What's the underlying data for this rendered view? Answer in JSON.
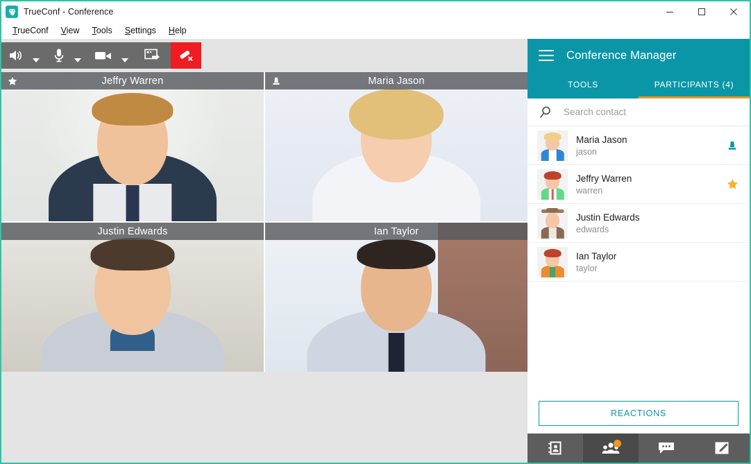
{
  "window": {
    "title": "TrueConf - Conference",
    "logo_icon": "trueconf-logo-icon",
    "controls": {
      "minimize": "minimize-icon",
      "maximize": "maximize-icon",
      "close": "close-icon"
    },
    "accent_border": "#2ec4a6"
  },
  "menubar": {
    "items": [
      {
        "label": "TrueConf",
        "mnemonic": "T",
        "rest": "rueConf"
      },
      {
        "label": "View",
        "mnemonic": "V",
        "rest": "iew"
      },
      {
        "label": "Tools",
        "mnemonic": "T",
        "rest": "ools"
      },
      {
        "label": "Settings",
        "mnemonic": "S",
        "rest": "ettings"
      },
      {
        "label": "Help",
        "mnemonic": "H",
        "rest": "elp"
      }
    ]
  },
  "toolbar": {
    "background": "#6b6b6b",
    "buttons": [
      {
        "name": "speaker-button",
        "icon": "speaker-icon",
        "has_caret": true
      },
      {
        "name": "microphone-button",
        "icon": "microphone-icon",
        "has_caret": true
      },
      {
        "name": "camera-button",
        "icon": "camera-icon",
        "has_caret": true
      },
      {
        "name": "screen-share-button",
        "icon": "screen-share-icon",
        "has_caret": false
      }
    ],
    "hangup": {
      "name": "hangup-button",
      "icon": "hangup-icon",
      "color": "#ef1c22"
    }
  },
  "video_grid": {
    "tiles": [
      {
        "name": "Jeffry Warren",
        "badge": "star-icon",
        "badge_label": "podium owner"
      },
      {
        "name": "Maria Jason",
        "badge": "podium-icon",
        "badge_label": "speaker"
      },
      {
        "name": "Justin Edwards",
        "badge": "",
        "badge_label": ""
      },
      {
        "name": "Ian Taylor",
        "badge": "",
        "badge_label": ""
      }
    ]
  },
  "conference_manager": {
    "title": "Conference Manager",
    "menu_icon": "hamburger-icon",
    "accent": "#0b96a8",
    "tab_underline": "#f2961e",
    "tabs": [
      {
        "label": "TOOLS",
        "active": false
      },
      {
        "label": "PARTICIPANTS (4)",
        "active": true
      }
    ],
    "search": {
      "icon": "search-icon",
      "placeholder": "Search contact",
      "value": ""
    },
    "participants": [
      {
        "name": "Maria Jason",
        "login": "jason",
        "badge": "podium-icon",
        "badge_color": "#0b96a8"
      },
      {
        "name": "Jeffry Warren",
        "login": "warren",
        "badge": "star-icon",
        "badge_color": "#f5b324"
      },
      {
        "name": "Justin Edwards",
        "login": "edwards",
        "badge": "",
        "badge_color": ""
      },
      {
        "name": "Ian Taylor",
        "login": "taylor",
        "badge": "",
        "badge_color": ""
      }
    ],
    "reactions_button": "REACTIONS",
    "bottom_bar": [
      {
        "name": "address-book-button",
        "icon": "address-book-icon",
        "active": false,
        "badge": false
      },
      {
        "name": "participants-button",
        "icon": "participants-icon",
        "active": true,
        "badge": true
      },
      {
        "name": "chat-button",
        "icon": "chat-icon",
        "active": false,
        "badge": false
      },
      {
        "name": "whiteboard-button",
        "icon": "whiteboard-icon",
        "active": false,
        "badge": false
      }
    ]
  }
}
